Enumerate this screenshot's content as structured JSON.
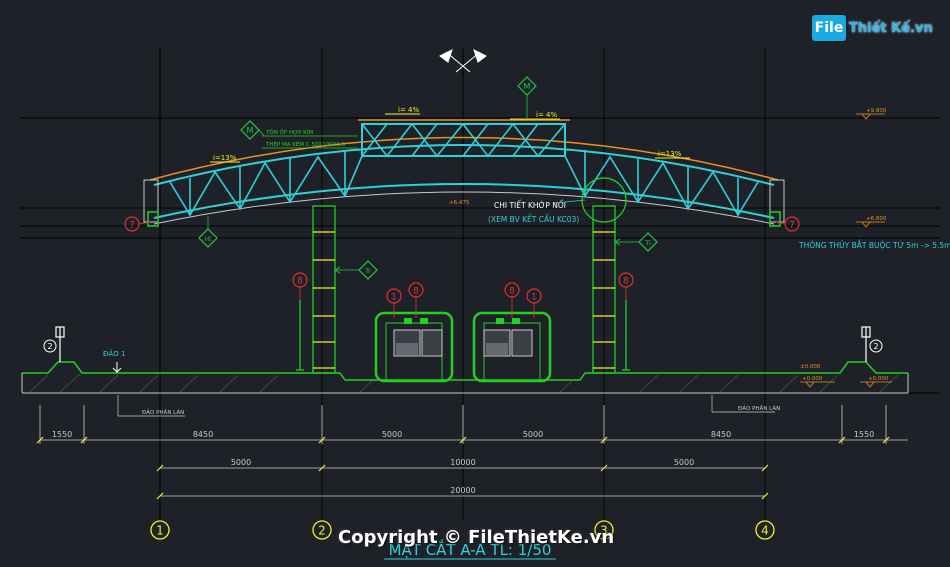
{
  "watermark": {
    "logo_mark": "File",
    "logo_text": "Thiết Kế.vn",
    "copyright": "Copyright © FileThietKe.vn"
  },
  "drawing": {
    "title": "MẶT CẮT A-A TL: 1/50",
    "colors": {
      "background": "#1e2228",
      "grid": "#000000",
      "truss": "#2fd0d8",
      "green": "#22d022",
      "dim": "#c8c8c8",
      "marker_red": "#e03030",
      "roof_orange": "#e89020",
      "yellow": "#f0f020",
      "tag_green": "#20c840"
    },
    "labels": {
      "slope_top_left": "i= 4%",
      "slope_top_right": "i= 4%",
      "slope_left": "i=13%",
      "slope_right": "i=13%",
      "roof_note_1": "TÔN ỐP HỢP KIM",
      "roof_note_2": "THÉP MẠ KẼM C 50X100X1.5",
      "joint_detail_1": "CHI TIẾT KHỚP NỐI",
      "joint_detail_2": "(XEM BV KẾT CẤU KC03)",
      "clearance": "THÔNG THỦY BẮT BUỘC TỪ 5m -> 5.5m",
      "island": "ĐẢO 1",
      "lane_left": "ĐẢO PHÂN LÀN",
      "lane_right": "ĐẢO PHÂN LÀN",
      "elev_top": "+9.800",
      "elev_mid": "+6.800",
      "elev_truss": "+6.475",
      "elev_left_small": "±0.000",
      "elev_right_1": "+0.000",
      "elev_right_2": "+0.000"
    },
    "tags": {
      "m_left": "M",
      "m_top": "M",
      "ht": "Ht",
      "ti": "Ti",
      "tr": "Tr"
    },
    "circle_markers": {
      "seven": "7",
      "eight": "8",
      "one": "1",
      "two": "2"
    },
    "dimensions": {
      "row1": [
        "1550",
        "8450",
        "5000",
        "5000",
        "8450",
        "1550"
      ],
      "row2": [
        "5000",
        "10000",
        "5000"
      ],
      "row3": [
        "20000"
      ]
    },
    "grid_axes": [
      "1",
      "2",
      "3",
      "4"
    ]
  }
}
